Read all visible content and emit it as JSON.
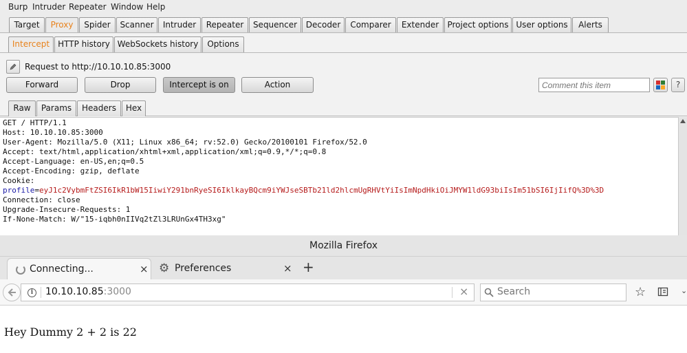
{
  "burp": {
    "menu": [
      "Burp",
      "Intruder",
      "Repeater",
      "Window",
      "Help"
    ],
    "main_tabs": [
      "Target",
      "Proxy",
      "Spider",
      "Scanner",
      "Intruder",
      "Repeater",
      "Sequencer",
      "Decoder",
      "Comparer",
      "Extender",
      "Project options",
      "User options",
      "Alerts"
    ],
    "main_active": "Proxy",
    "proxy_tabs": [
      "Intercept",
      "HTTP history",
      "WebSockets history",
      "Options"
    ],
    "proxy_active": "Intercept",
    "request_label": "Request to http://10.10.10.85:3000",
    "buttons": {
      "forward": "Forward",
      "drop": "Drop",
      "intercept": "Intercept is on",
      "action": "Action"
    },
    "comment_placeholder": "Comment this item",
    "help_label": "?",
    "view_tabs": [
      "Raw",
      "Params",
      "Headers",
      "Hex"
    ],
    "view_active": "Raw",
    "request": {
      "line1": "GET / HTTP/1.1",
      "line2": "Host: 10.10.10.85:3000",
      "line3": "User-Agent: Mozilla/5.0 (X11; Linux x86_64; rv:52.0) Gecko/20100101 Firefox/52.0",
      "line4": "Accept: text/html,application/xhtml+xml,application/xml;q=0.9,*/*;q=0.8",
      "line5": "Accept-Language: en-US,en;q=0.5",
      "line6": "Accept-Encoding: gzip, deflate",
      "line7": "Cookie:",
      "cookie_name": "profile",
      "cookie_eq": "=",
      "cookie_value": "eyJ1c2VybmFtZSI6IkR1bW15IiwiY291bnRyeSI6IklkayBQcm9iYWJseSBTb21ld2hlcmUgRHVtYiIsImNpdHkiOiJMYW1ldG93biIsIm51bSI6IjIifQ%3D%3D",
      "line9": "Connection: close",
      "line10": "Upgrade-Insecure-Requests: 1",
      "line11": "If-None-Match: W/\"15-iqbh0nIIVq2tZl3LRUnGx4TH3xg\""
    }
  },
  "firefox": {
    "window_title": "Mozilla Firefox",
    "tabs": [
      {
        "label": "Connecting...",
        "close": "×"
      },
      {
        "label": "Preferences",
        "close": "×"
      }
    ],
    "new_tab": "+",
    "url_host": "10.10.10.85",
    "url_port": ":3000",
    "url_clear": "×",
    "search_placeholder": "Search",
    "page_text": "Hey Dummy 2 + 2 is 22"
  },
  "colors": {
    "active_tab_text": "#e8821c",
    "cookie_key": "#1a1aa6",
    "cookie_value": "#b51a1a"
  }
}
